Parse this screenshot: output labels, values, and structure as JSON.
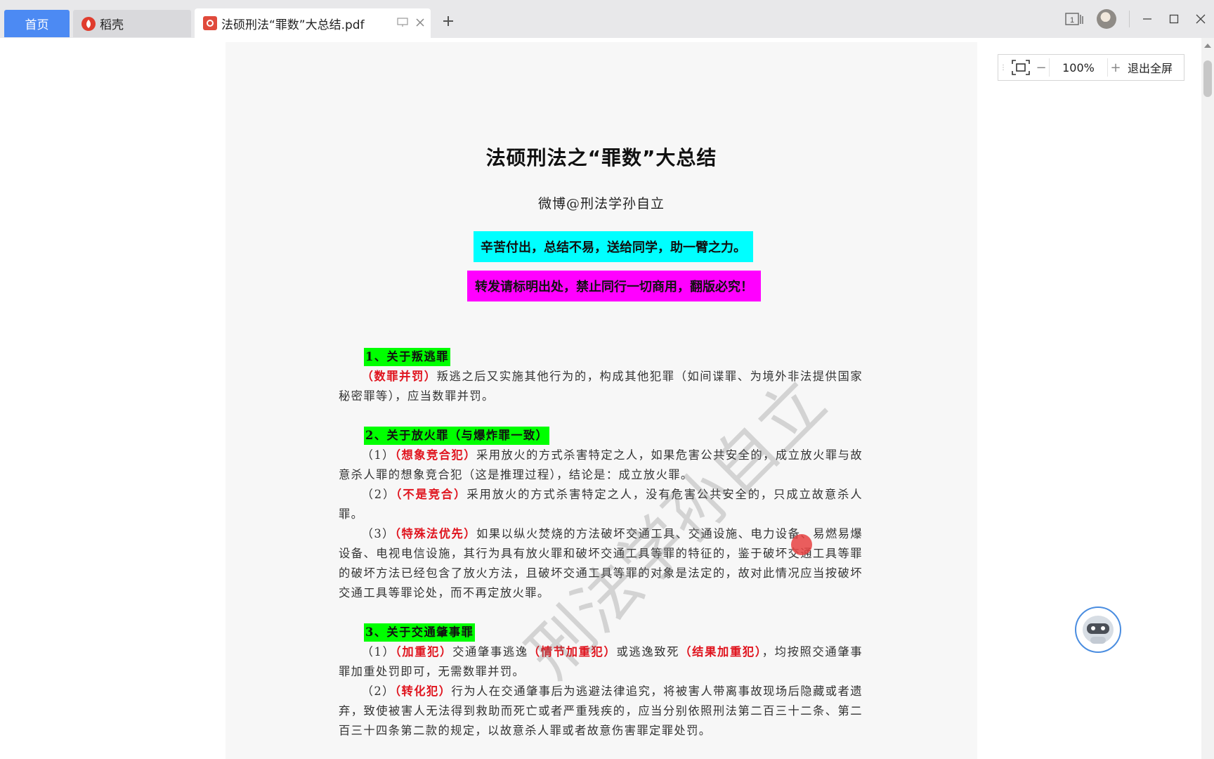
{
  "tabs": {
    "home_label": "首页",
    "daoke_label": "稻壳",
    "pdf_label": "法硕刑法“罪数”大总结.pdf",
    "new_tab_symbol": "+"
  },
  "window": {
    "page_count_badge": "1"
  },
  "zoom": {
    "value": "100%",
    "minus": "−",
    "plus": "+",
    "exit_fullscreen": "退出全屏"
  },
  "document": {
    "title": "法硕刑法之“罪数”大总结",
    "author": "微博@刑法学孙自立",
    "banner_cyan": "辛苦付出，总结不易，送给同学，助一臂之力。",
    "banner_magenta": "转发请标明出处，禁止同行一切商用，翻版必究！",
    "sections": [
      {
        "heading": "1、关于叛逃罪",
        "paragraphs": [
          {
            "pre": "",
            "hl": "（数罪并罚）",
            "text": "叛逃之后又实施其他行为的，构成其他犯罪（如间谍罪、为境外非法提供国家秘密罪等），应当数罪并罚。"
          }
        ]
      },
      {
        "heading": "2、关于放火罪（与爆炸罪一致）",
        "paragraphs": [
          {
            "pre": "（1）",
            "hl": "（想象竞合犯）",
            "text": "采用放火的方式杀害特定之人，如果危害公共安全的，成立放火罪与故意杀人罪的想象竞合犯（这是推理过程），结论是：成立放火罪。"
          },
          {
            "pre": "（2）",
            "hl": "（不是竞合）",
            "text": "采用放火的方式杀害特定之人，没有危害公共安全的，只成立故意杀人罪。"
          },
          {
            "pre": "（3）",
            "hl": "（特殊法优先）",
            "text": "如果以纵火焚烧的方法破坏交通工具、交通设施、电力设备、易燃易爆设备、电视电信设施，其行为具有放火罪和破坏交通工具等罪的特征的，鉴于破坏交通工具等罪的破坏方法已经包含了放火方法，且破坏交通工具等罪的对象是法定的，故对此情况应当按破坏交通工具等罪论处，而不再定放火罪。"
          }
        ]
      },
      {
        "heading": "3、关于交通肇事罪",
        "paragraphs": [
          {
            "pre": "（1）",
            "hl": "（加重犯）",
            "text": "交通肇事逃逸",
            "hl2": "（情节加重犯）",
            "text2": "或逃逸致死",
            "hl3": "（结果加重犯）",
            "text3": "，均按照交通肇事罪加重处罚即可，无需数罪并罚。"
          },
          {
            "pre": "（2）",
            "hl": "（转化犯）",
            "text": "行为人在交通肇事后为逃避法律追究，将被害人带离事故现场后隐藏或者遗弃，致使被害人无法得到救助而死亡或者严重残疾的，应当分别依照刑法第二百三十二条、第二百三十四条第二款的规定，以故意杀人罪或者故意伤害罪定罪处罚。"
          }
        ]
      }
    ],
    "watermark": "刑法学孙自立"
  }
}
